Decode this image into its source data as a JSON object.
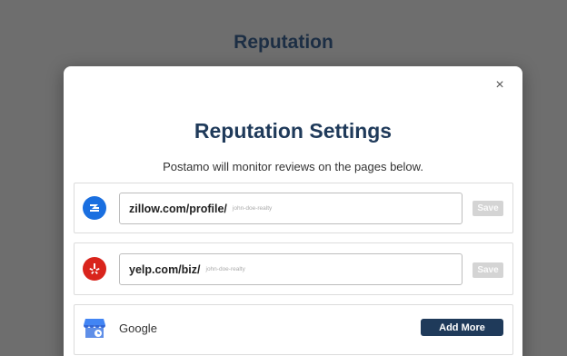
{
  "page": {
    "title": "Reputation"
  },
  "modal": {
    "title": "Reputation Settings",
    "subtitle": "Postamo will monitor reviews on the pages below.",
    "close_glyph": "×"
  },
  "sources": [
    {
      "service": "zillow",
      "icon": "zillow-icon",
      "url_prefix": "zillow.com/profile/",
      "placeholder": "john-doe-realty",
      "save_label": "Save"
    },
    {
      "service": "yelp",
      "icon": "yelp-icon",
      "url_prefix": "yelp.com/biz/",
      "placeholder": "john-doe-realty",
      "save_label": "Save"
    },
    {
      "service": "google",
      "icon": "google-my-business-icon",
      "label": "Google",
      "action_label": "Add More"
    }
  ],
  "colors": {
    "overlay": "#6e6e6e",
    "primary_navy": "#1f3a5a",
    "zillow_blue": "#1a6fe0",
    "yelp_red": "#d9241c",
    "disabled_button": "#d4d4d4"
  }
}
